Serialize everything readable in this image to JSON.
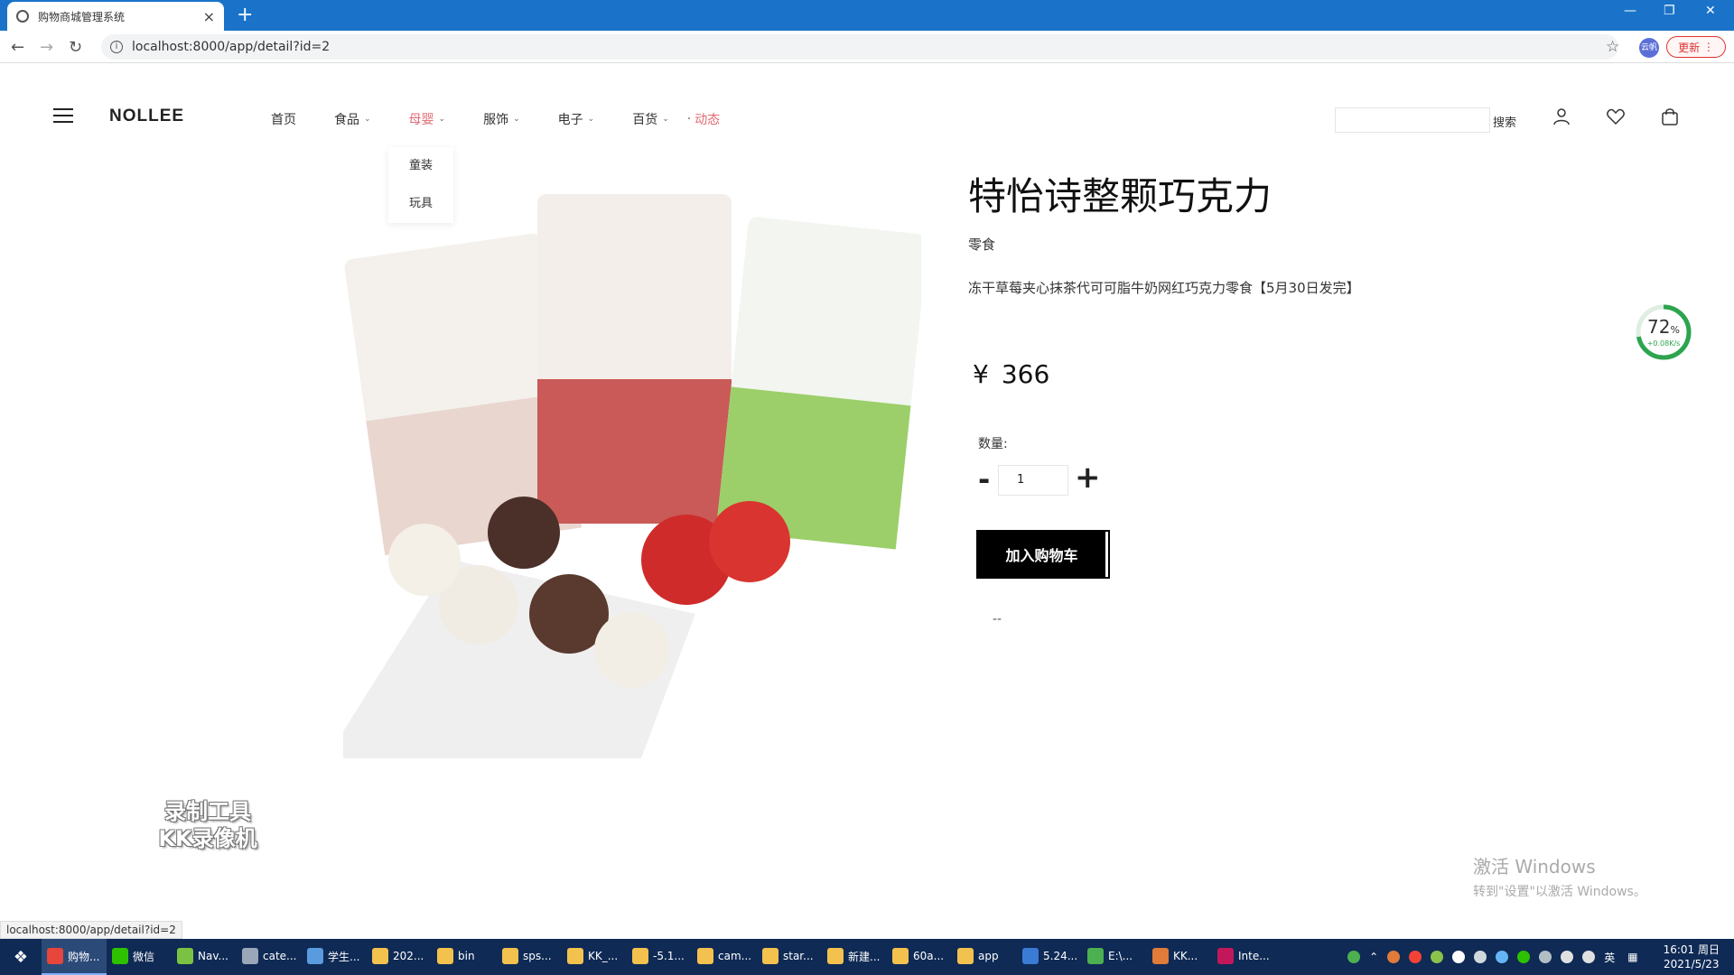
{
  "browser": {
    "tab_title": "购物商城管理系统",
    "new_tab": "+",
    "close": "×",
    "url": "localhost:8000/app/detail?id=2",
    "profile_label": "云帆",
    "update_label": "更新"
  },
  "site": {
    "logo": "NOLLEE",
    "nav": [
      {
        "label": "首页",
        "has_dropdown": false
      },
      {
        "label": "食品",
        "has_dropdown": true
      },
      {
        "label": "母婴",
        "has_dropdown": true
      },
      {
        "label": "服饰",
        "has_dropdown": true
      },
      {
        "label": "电子",
        "has_dropdown": true
      },
      {
        "label": "百货",
        "has_dropdown": true
      },
      {
        "label": "动态",
        "has_dropdown": false
      }
    ],
    "dropdown_items": [
      "童装",
      "玩具"
    ],
    "search_placeholder": "",
    "search_label": "搜索",
    "header_icons": [
      "user-icon",
      "heart-icon",
      "cart-icon"
    ]
  },
  "product": {
    "title": "特怡诗整颗巧克力",
    "category": "零食",
    "description": "冻干草莓夹心抹茶代可可脂牛奶网红巧克力零食【5月30日发完】",
    "currency": "¥",
    "price": "366",
    "quantity_label": "数量:",
    "quantity_value": "1",
    "minus": "-",
    "plus": "+",
    "add_to_cart": "加入购物车",
    "extra": "--"
  },
  "overlays": {
    "speed_percent": "72",
    "speed_percent_unit": "%",
    "speed_rate": "+0.08K/s",
    "watermark_line1": "录制工具",
    "watermark_line2": "KK录像机",
    "activate_title": "激活 Windows",
    "activate_sub": "转到\"设置\"以激活 Windows。",
    "status_url": "localhost:8000/app/detail?id=2"
  },
  "taskbar": {
    "items": [
      {
        "label": "购物...",
        "color": "#e8453c",
        "active": true
      },
      {
        "label": "微信",
        "color": "#2dc100",
        "active": false
      },
      {
        "label": "Nav...",
        "color": "#7cc242",
        "active": false
      },
      {
        "label": "cate...",
        "color": "#9aa7b8",
        "active": false
      },
      {
        "label": "学生...",
        "color": "#5a9be0",
        "active": false
      },
      {
        "label": "202...",
        "color": "#f2c14e",
        "active": false
      },
      {
        "label": "bin",
        "color": "#f2c14e",
        "active": false
      },
      {
        "label": "sps...",
        "color": "#f2c14e",
        "active": false
      },
      {
        "label": "KK_...",
        "color": "#f2c14e",
        "active": false
      },
      {
        "label": "-5.1...",
        "color": "#f2c14e",
        "active": false
      },
      {
        "label": "cam...",
        "color": "#f2c14e",
        "active": false
      },
      {
        "label": "star...",
        "color": "#f2c14e",
        "active": false
      },
      {
        "label": "新建...",
        "color": "#f2c14e",
        "active": false
      },
      {
        "label": "60a...",
        "color": "#f2c14e",
        "active": false
      },
      {
        "label": "app",
        "color": "#f2c14e",
        "active": false
      },
      {
        "label": "5.24...",
        "color": "#3a7bd5",
        "active": false
      },
      {
        "label": "E:\\...",
        "color": "#4caf50",
        "active": false
      },
      {
        "label": "KK...",
        "color": "#e07b39",
        "active": false
      },
      {
        "label": "Inte...",
        "color": "#c2185b",
        "active": false
      }
    ],
    "ime": "英",
    "time": "16:01 周日",
    "date": "2021/5/23"
  },
  "colors": {
    "accent_nav": "#e26b73",
    "titlebar": "#1a73c9",
    "taskbar": "#0f2a55",
    "speed_ring": "#2da44e"
  }
}
